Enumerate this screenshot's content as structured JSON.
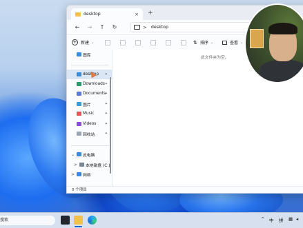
{
  "window": {
    "tab_title": "desktop",
    "tab_close": "×",
    "new_tab": "+",
    "address": "desktop",
    "address_sep": ">"
  },
  "nav": {
    "back": "←",
    "forward": "→",
    "up": "↑",
    "refresh": "↻"
  },
  "toolbar": {
    "new_label": "新建",
    "new_caret": "⌄",
    "sort_label": "排序",
    "sort_caret": "⌄",
    "view_label": "查看",
    "view_caret": "⌄"
  },
  "sidebar": {
    "items": [
      {
        "label": "图库",
        "color": "#3b8ad9",
        "pinned": false
      },
      {
        "label": "desktop",
        "color": "#3b8ad9",
        "pinned": true,
        "selected": true
      },
      {
        "label": "Downloads",
        "color": "#2b9a6b",
        "pinned": true
      },
      {
        "label": "Documents",
        "color": "#5b7bd4",
        "pinned": true
      },
      {
        "label": "图片",
        "color": "#3a9ad8",
        "pinned": true
      },
      {
        "label": "Music",
        "color": "#e0565a",
        "pinned": true
      },
      {
        "label": "Videos",
        "color": "#8a4fd0",
        "pinned": true
      },
      {
        "label": "回收站",
        "color": "#9aa6b2",
        "pinned": true
      }
    ],
    "tree": [
      {
        "label": "此电脑",
        "color": "#3b8ad9",
        "chev": "⌄"
      },
      {
        "label": "本地磁盘 (C:)",
        "color": "#7b8794",
        "chev": ">"
      },
      {
        "label": "网络",
        "color": "#3b8ad9",
        "chev": ">"
      }
    ],
    "pin_glyph": "📌"
  },
  "content": {
    "empty_message": "此文件夹为空。"
  },
  "status": {
    "item_count": "0 个项目"
  },
  "taskbar": {
    "search_label": "搜索",
    "tray_lang": "中",
    "tray_input": "拼"
  }
}
